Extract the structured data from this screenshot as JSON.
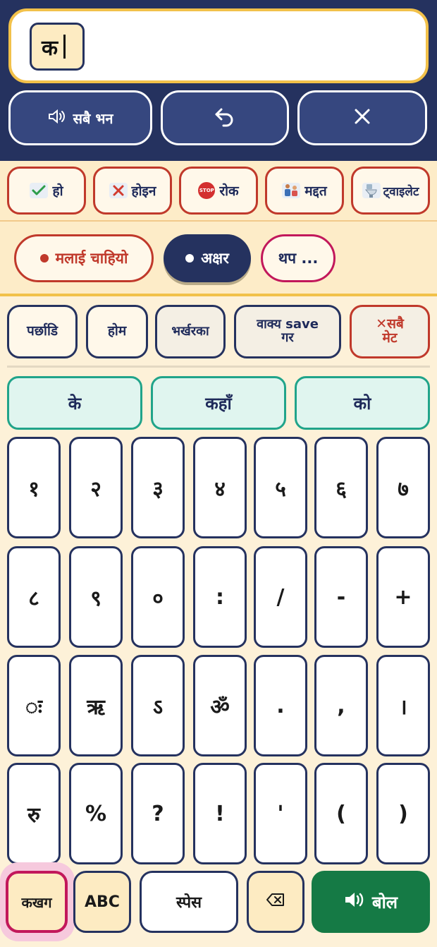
{
  "display": {
    "text": "क"
  },
  "controls": {
    "speak_all_label": "सबै भन"
  },
  "quick_phrases": [
    {
      "label": "हो",
      "icon": "check-icon"
    },
    {
      "label": "होइन",
      "icon": "cross-icon"
    },
    {
      "label": "रोक",
      "icon": "stop-sign-icon",
      "icon_text": "STOP"
    },
    {
      "label": "मद्दत",
      "icon": "help-people-icon"
    },
    {
      "label": "ट्वाइलेट",
      "icon": "toilet-icon"
    }
  ],
  "categories": [
    {
      "label": "मलाई चाहियो"
    },
    {
      "label": "अक्षर",
      "active": true
    },
    {
      "label": "थप ..."
    }
  ],
  "actions": [
    {
      "label": "पर्छाडि"
    },
    {
      "label": "होम"
    },
    {
      "label": "भर्खरका"
    },
    {
      "label_line1": "वाक्य save",
      "label_line2": "गर"
    },
    {
      "label_line1": "सबै",
      "label_line2": "मेट"
    }
  ],
  "suggestions": [
    "के",
    "कहाँ",
    "को"
  ],
  "keys": [
    [
      "१",
      "२",
      "३",
      "४",
      "५",
      "६",
      "७"
    ],
    [
      "८",
      "९",
      "०",
      ":",
      "/",
      "-",
      "+"
    ],
    [
      "◌ः",
      "ऋ",
      "ऽ",
      "ॐ",
      ".",
      ",",
      "।"
    ],
    [
      "रु",
      "%",
      "?",
      "!",
      "'",
      "(",
      ")"
    ]
  ],
  "bottom": {
    "script_label": "कखग",
    "abc_label": "ABC",
    "space_label": "स्पेस",
    "speak_label": "बोल"
  },
  "colors": {
    "navy": "#25325f",
    "cream": "#fdf1d8",
    "gold": "#f2c14a",
    "red": "#c0392b",
    "teal": "#21a48a",
    "magenta": "#c2185b",
    "green": "#157a45"
  }
}
